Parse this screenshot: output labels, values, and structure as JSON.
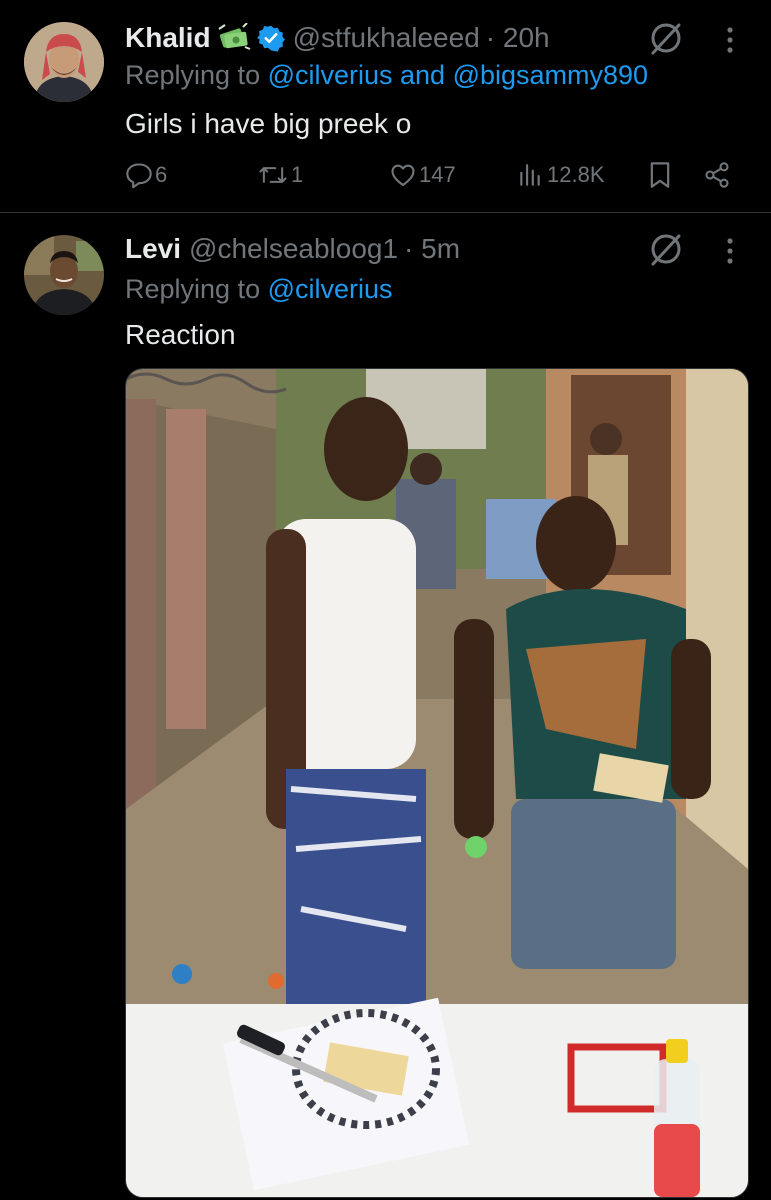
{
  "tweets": [
    {
      "name": "Khalid",
      "handle": "@stfukhaleeed",
      "time": "· 20h",
      "reply_prefix": "Replying to ",
      "reply_mentions": "@cilverius and @bigsammy890",
      "text": "Girls i have big preek o",
      "stats": {
        "replies": "6",
        "retweets": "1",
        "likes": "147",
        "views": "12.8K"
      }
    },
    {
      "name": "Levi",
      "handle": "@chelseabloog1",
      "time": "· 5m",
      "reply_prefix": "Replying to ",
      "reply_mentions": "@cilverius",
      "text": "Reaction"
    }
  ],
  "colors": {
    "accent": "#1d9bf0",
    "verified": "#1d9bf0",
    "muted": "#71767b",
    "background": "#000000"
  }
}
